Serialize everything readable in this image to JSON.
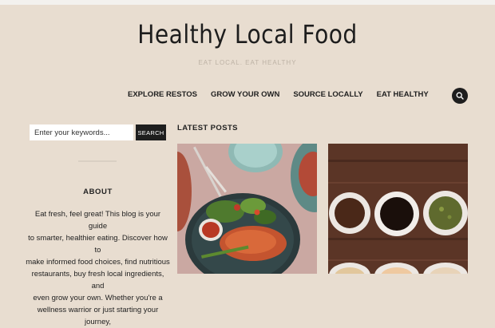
{
  "site": {
    "title": "Healthy Local Food",
    "tagline": "EAT LOCAL. EAT HEALTHY"
  },
  "nav": {
    "items": [
      {
        "label": "EXPLORE RESTOS"
      },
      {
        "label": "GROW YOUR OWN"
      },
      {
        "label": "SOURCE LOCALLY"
      },
      {
        "label": "EAT HEALTHY"
      }
    ],
    "search_icon": "search-icon"
  },
  "sidebar": {
    "search": {
      "placeholder": "Enter your keywords...",
      "value": "",
      "button_label": "SEARCH"
    },
    "about": {
      "heading": "ABOUT",
      "lines": [
        "Eat fresh, feel great! This blog is your guide",
        "to smarter, healthier eating. Discover how to",
        "make informed food choices, find nutritious",
        "restaurants, buy fresh local ingredients, and",
        "even grow your own. Whether you're a",
        "wellness warrior or just starting your journey,"
      ]
    }
  },
  "main": {
    "latest_heading": "LATEST POSTS",
    "posts": [
      {
        "image": "grilled-salmon-plate-photo"
      },
      {
        "image": "sauce-bowls-wooden-table-photo"
      }
    ]
  },
  "colors": {
    "background": "#e8ddd0",
    "dark": "#1e1e1e",
    "topbar": "#f3f1ee"
  }
}
